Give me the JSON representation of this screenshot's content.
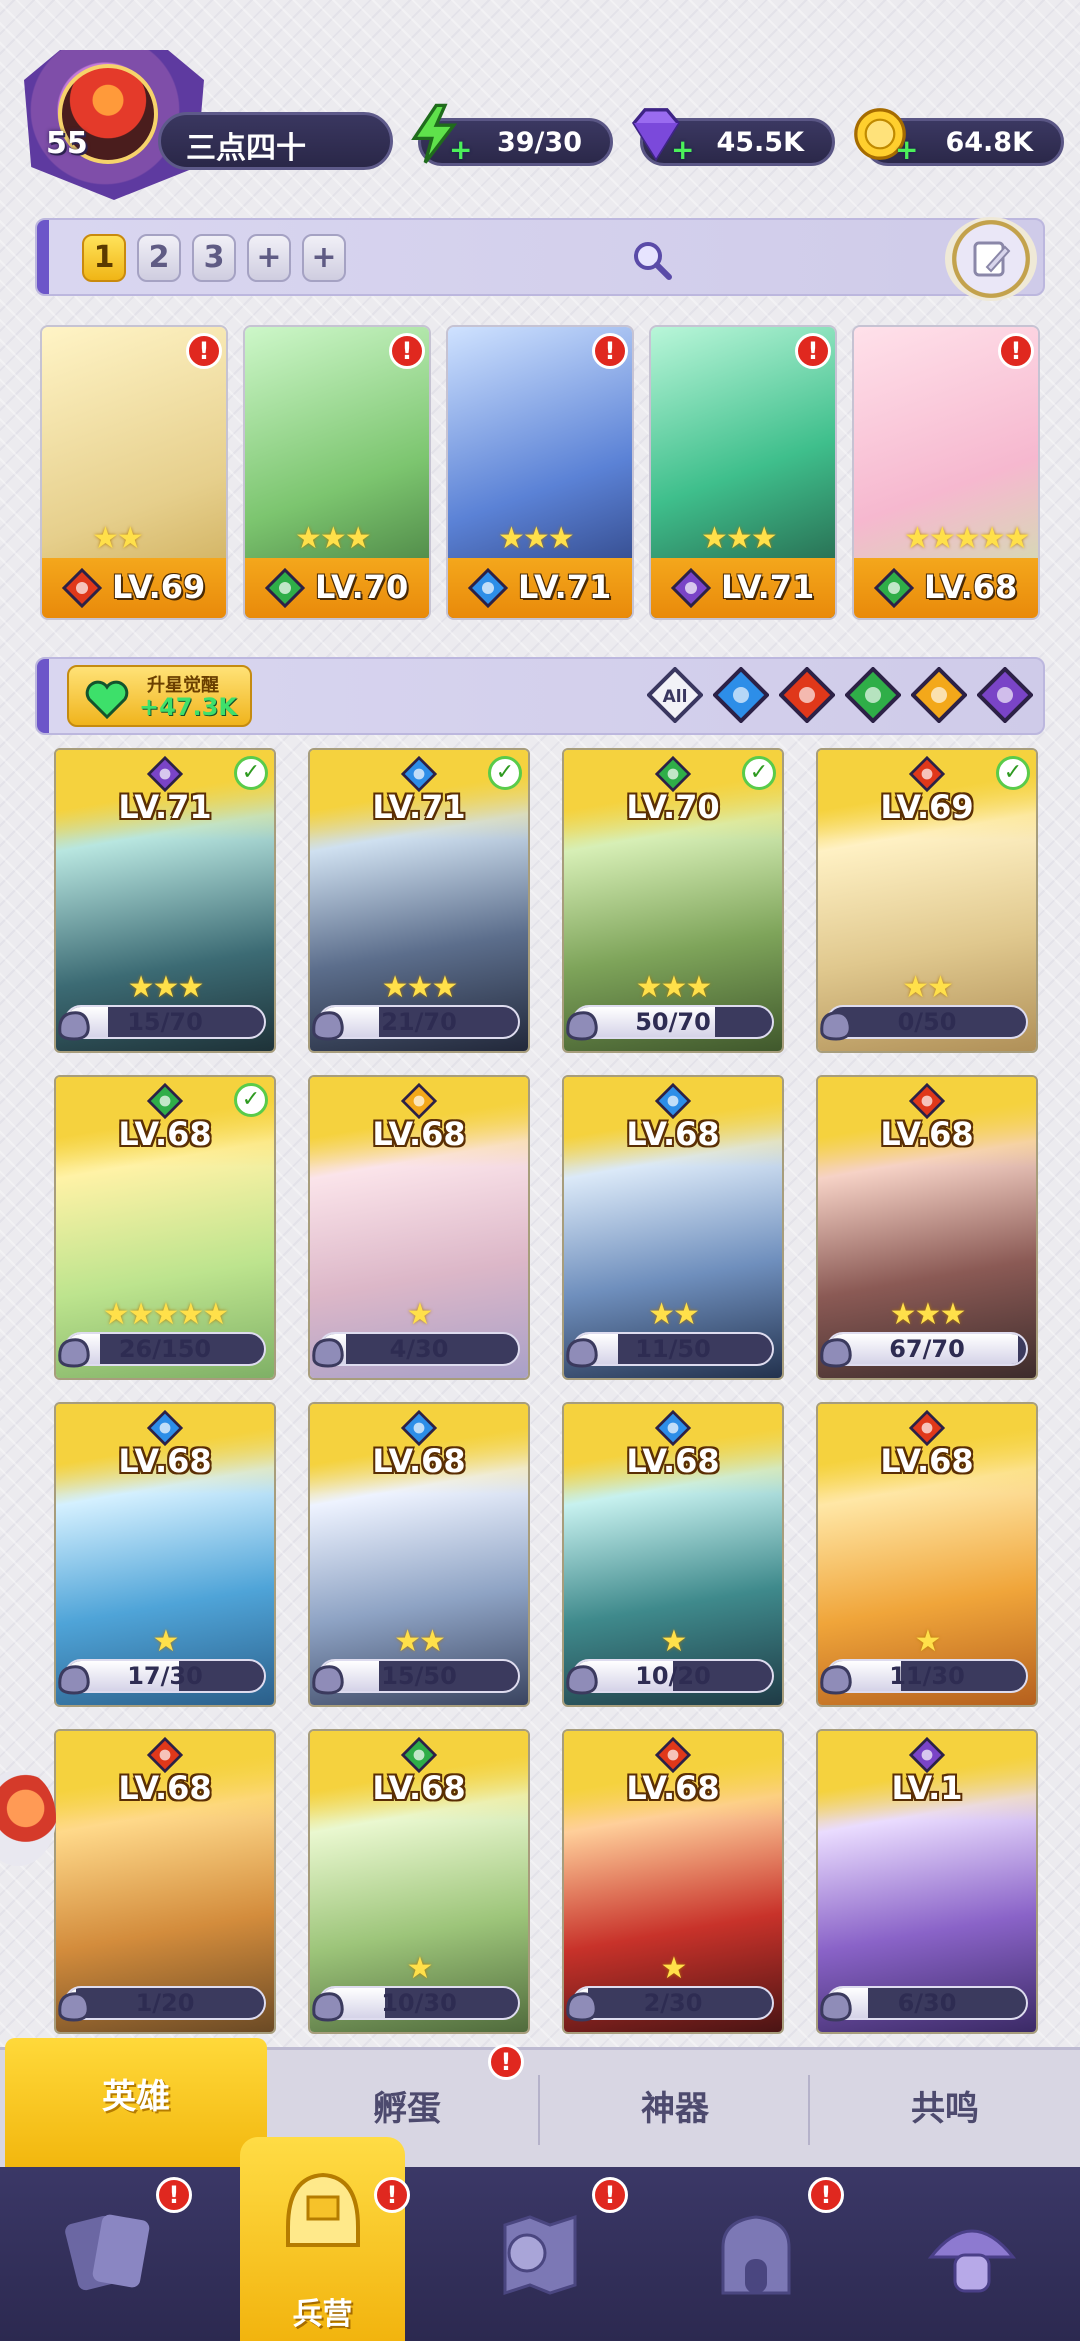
{
  "player": {
    "level": "55",
    "name": "三点四十"
  },
  "resources": {
    "energy": "39/30",
    "gems": "45.5K",
    "gold": "64.8K"
  },
  "team_tabs": [
    "1",
    "2",
    "3",
    "+",
    "+"
  ],
  "team": [
    {
      "level": "LV.69",
      "element": "fire",
      "stars": "★★"
    },
    {
      "level": "LV.70",
      "element": "wind",
      "stars": "★★★"
    },
    {
      "level": "LV.71",
      "element": "water",
      "stars": "★★★"
    },
    {
      "level": "LV.71",
      "element": "dark",
      "stars": "★★★"
    },
    {
      "level": "LV.68",
      "element": "wind",
      "stars": "★★★★★"
    }
  ],
  "awaken": {
    "title": "升星觉醒",
    "value": "+47.3K"
  },
  "filters": [
    "All",
    "water",
    "fire",
    "wind",
    "light",
    "dark"
  ],
  "heroes": [
    {
      "level": "LV.71",
      "element": "dark",
      "stars": "★★★",
      "fragments": "15/70",
      "progress": 0.21,
      "checked": true
    },
    {
      "level": "LV.71",
      "element": "water",
      "stars": "★★★",
      "fragments": "21/70",
      "progress": 0.3,
      "checked": true
    },
    {
      "level": "LV.70",
      "element": "wind",
      "stars": "★★★",
      "fragments": "50/70",
      "progress": 0.71,
      "checked": true
    },
    {
      "level": "LV.69",
      "element": "fire",
      "stars": "★★",
      "fragments": "0/50",
      "progress": 0,
      "checked": true
    },
    {
      "level": "LV.68",
      "element": "wind",
      "stars": "★★★★★",
      "fragments": "26/150",
      "progress": 0.17,
      "checked": true
    },
    {
      "level": "LV.68",
      "element": "light",
      "stars": "★",
      "fragments": "4/30",
      "progress": 0.13,
      "checked": false
    },
    {
      "level": "LV.68",
      "element": "water",
      "stars": "★★",
      "fragments": "11/50",
      "progress": 0.22,
      "checked": false
    },
    {
      "level": "LV.68",
      "element": "fire",
      "stars": "★★★",
      "fragments": "67/70",
      "progress": 0.96,
      "checked": false
    },
    {
      "level": "LV.68",
      "element": "water",
      "stars": "★",
      "fragments": "17/30",
      "progress": 0.57,
      "checked": false
    },
    {
      "level": "LV.68",
      "element": "water",
      "stars": "★★",
      "fragments": "15/50",
      "progress": 0.3,
      "checked": false
    },
    {
      "level": "LV.68",
      "element": "water",
      "stars": "★",
      "fragments": "10/20",
      "progress": 0.5,
      "checked": false
    },
    {
      "level": "LV.68",
      "element": "fire",
      "stars": "★",
      "fragments": "11/30",
      "progress": 0.37,
      "checked": false
    },
    {
      "level": "LV.68",
      "element": "fire",
      "stars": "",
      "fragments": "1/20",
      "progress": 0.05,
      "checked": false
    },
    {
      "level": "LV.68",
      "element": "wind",
      "stars": "★",
      "fragments": "10/30",
      "progress": 0.33,
      "checked": false
    },
    {
      "level": "LV.68",
      "element": "fire",
      "stars": "★",
      "fragments": "2/30",
      "progress": 0.07,
      "checked": false
    },
    {
      "level": "LV.1",
      "element": "dark",
      "stars": "",
      "fragments": "6/30",
      "progress": 0.2,
      "checked": false
    }
  ],
  "subtabs": [
    "英雄",
    "孵蛋",
    "神器",
    "共鸣"
  ],
  "nav": {
    "barracks_label": "兵营"
  },
  "colors": {
    "fire": "#e0381a",
    "water": "#2d8ee8",
    "wind": "#2fae48",
    "light": "#f3a81a",
    "dark": "#7a44c7",
    "accent_yellow": "#f2b60d",
    "nav_bg": "#2c2950"
  }
}
